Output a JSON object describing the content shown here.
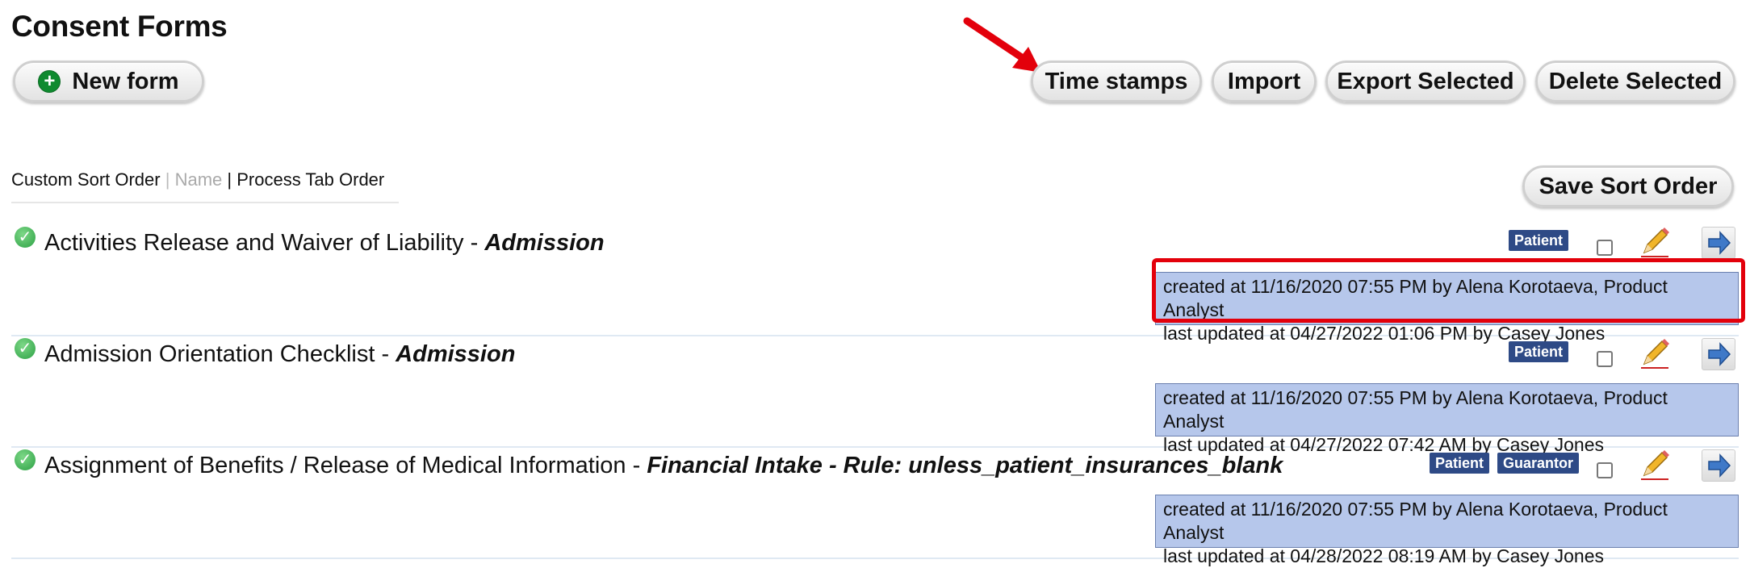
{
  "page": {
    "title": "Consent Forms"
  },
  "toolbar": {
    "new_form": "New form",
    "time_stamps": "Time stamps",
    "import": "Import",
    "export_selected": "Export Selected",
    "delete_selected": "Delete Selected",
    "save_sort_order": "Save Sort Order"
  },
  "sort": {
    "custom": "Custom Sort Order",
    "sep1": "|",
    "name": "Name",
    "sep2": "|",
    "process": "Process Tab Order"
  },
  "forms": [
    {
      "name": "Activities Release and Waiver of Liability",
      "separator": " - ",
      "tab": "Admission",
      "badges": [
        "Patient"
      ],
      "created": "created at 11/16/2020 07:55 PM by Alena Korotaeva, Product Analyst",
      "updated": "last updated at 04/27/2022 01:06 PM by Casey Jones"
    },
    {
      "name": "Admission Orientation Checklist",
      "separator": " - ",
      "tab": "Admission",
      "badges": [
        "Patient"
      ],
      "created": "created at 11/16/2020 07:55 PM by Alena Korotaeva, Product Analyst",
      "updated": "last updated at 04/27/2022 07:42 AM by Casey Jones"
    },
    {
      "name": "Assignment of Benefits / Release of Medical Information",
      "separator": " - ",
      "tab": "Financial Intake - Rule: unless_patient_insurances_blank",
      "badges": [
        "Patient",
        "Guarantor"
      ],
      "created": "created at 11/16/2020 07:55 PM by Alena Korotaeva, Product Analyst",
      "updated": "last updated at 04/28/2022 08:19 AM by Casey Jones"
    }
  ],
  "colors": {
    "badge": "#2e4a86",
    "stamp_bg": "#b6c7eb",
    "highlight": "#e3000b",
    "check": "#2ca044"
  }
}
